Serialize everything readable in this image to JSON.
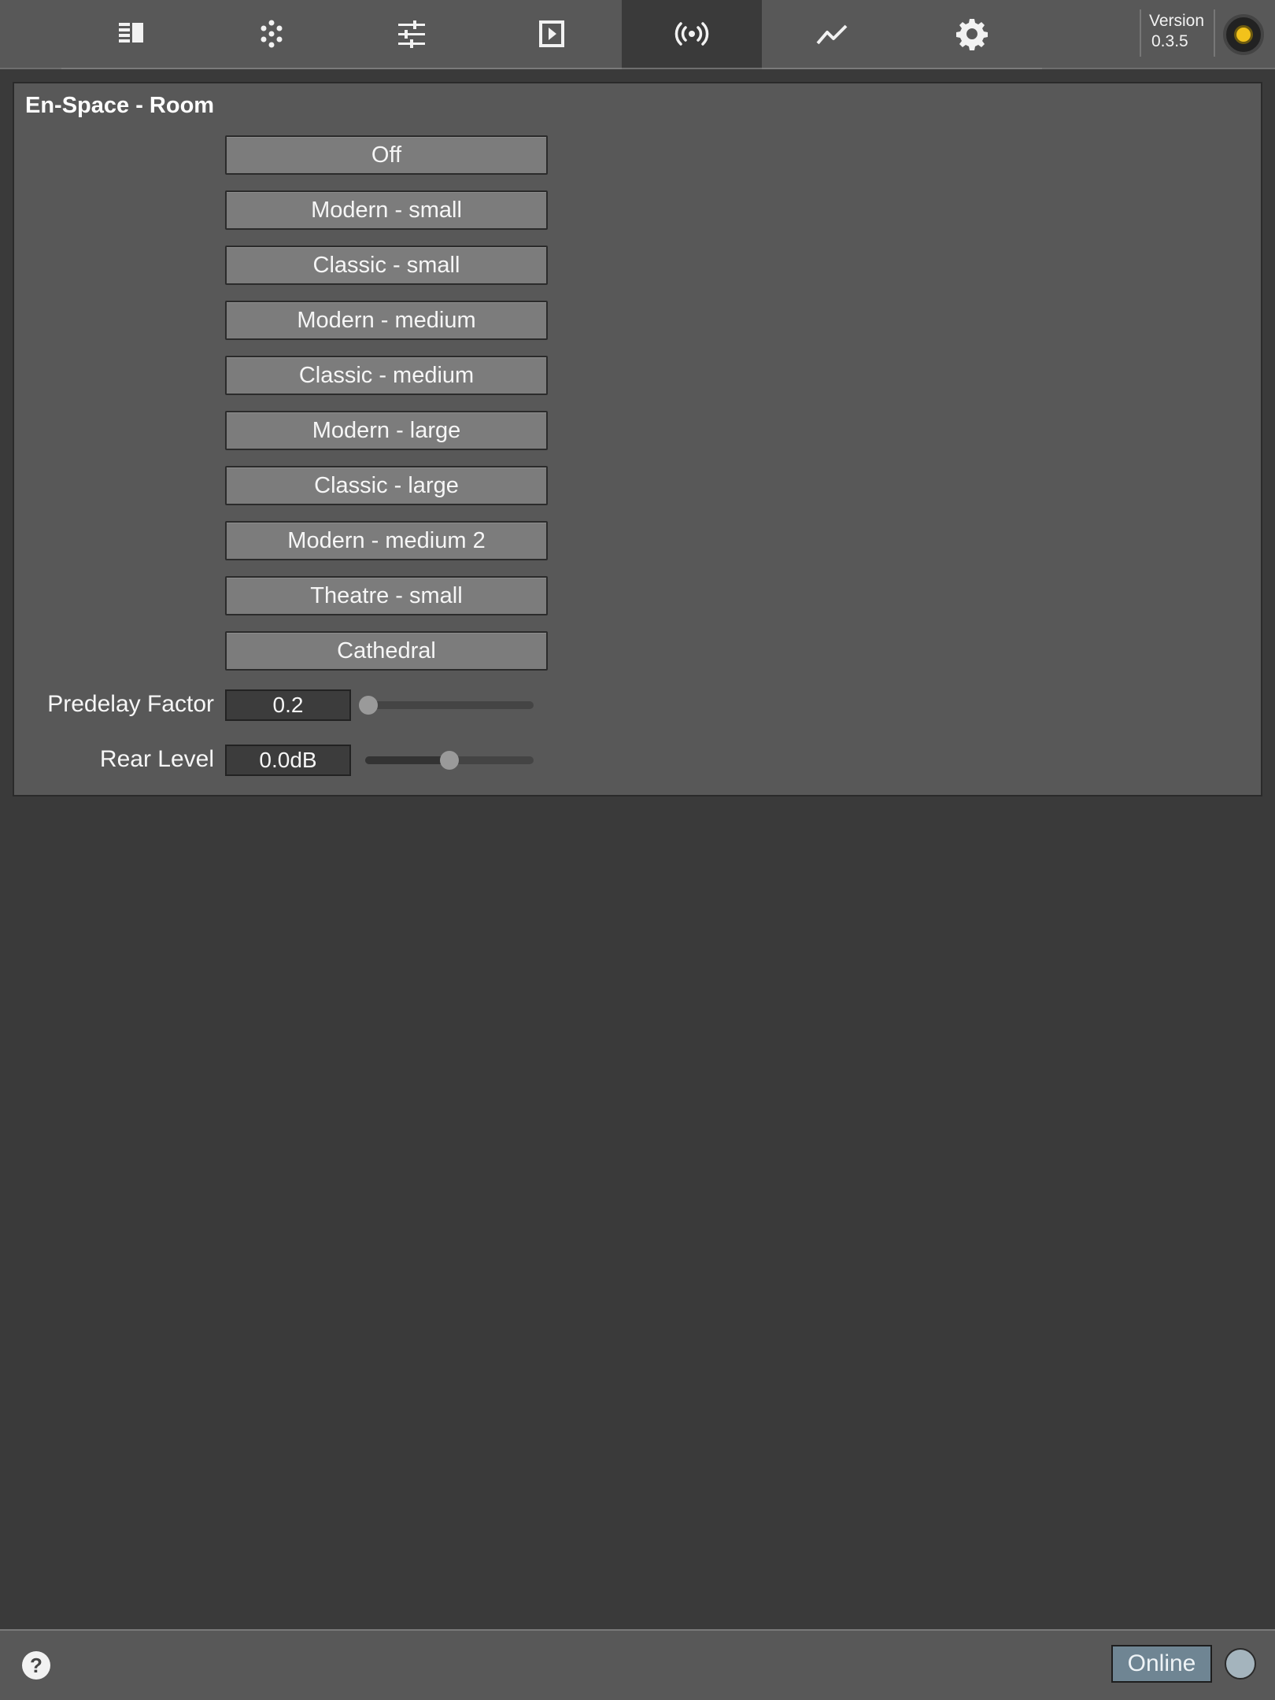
{
  "tabs": [
    {
      "icon": "list-panel-icon"
    },
    {
      "icon": "dots-grid-icon"
    },
    {
      "icon": "sliders-icon"
    },
    {
      "icon": "play-box-icon"
    },
    {
      "icon": "broadcast-icon",
      "active": true
    },
    {
      "icon": "trend-line-icon"
    },
    {
      "icon": "gear-icon"
    }
  ],
  "version": {
    "label": "Version",
    "number": "0.3.5"
  },
  "panel": {
    "title": "En-Space - Room",
    "presets": [
      "Off",
      "Modern - small",
      "Classic - small",
      "Modern - medium",
      "Classic - medium",
      "Modern - large",
      "Classic - large",
      "Modern - medium 2",
      "Theatre - small",
      "Cathedral"
    ],
    "predelay": {
      "label": "Predelay Factor",
      "value": "0.2",
      "slider_fraction": 0.02
    },
    "rear_level": {
      "label": "Rear Level",
      "value": "0.0dB",
      "slider_fraction": 0.5
    }
  },
  "footer": {
    "help": "?",
    "online_label": "Online"
  },
  "colors": {
    "background": "#3a3a3a",
    "panel": "#585858",
    "button": "#7c7c7c",
    "lamp": "#f2c21b",
    "online_button": "#6f8593",
    "connection_indicator": "#a4b4bd"
  }
}
